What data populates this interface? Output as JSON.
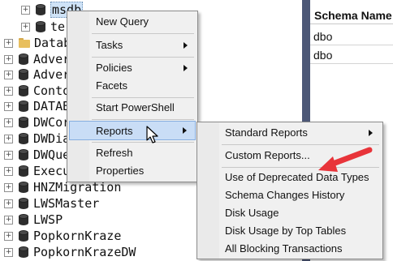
{
  "tree": {
    "items": [
      {
        "label": "msdb",
        "icon": "database-icon",
        "expander": "⊞",
        "selected": true
      },
      {
        "label": "ter",
        "icon": "database-icon",
        "expander": "⊞"
      },
      {
        "label": "Datab",
        "icon": "folder-icon",
        "expander": "⊞"
      },
      {
        "label": "Adver",
        "icon": "database-icon",
        "expander": "⊞"
      },
      {
        "label": "Adver",
        "icon": "database-icon",
        "expander": "⊞"
      },
      {
        "label": "Conto",
        "icon": "database-icon",
        "expander": "⊞"
      },
      {
        "label": "DATAB",
        "icon": "database-icon",
        "expander": "⊞"
      },
      {
        "label": "DWCor",
        "icon": "database-icon",
        "expander": "⊞"
      },
      {
        "label": "DWDia",
        "icon": "database-icon",
        "expander": "⊞"
      },
      {
        "label": "DWQue",
        "icon": "database-icon",
        "expander": "⊞"
      },
      {
        "label": "Execu",
        "icon": "database-icon",
        "expander": "⊞"
      },
      {
        "label": "HNZMigration",
        "icon": "database-icon",
        "expander": "⊞"
      },
      {
        "label": "LWSMaster",
        "icon": "database-icon",
        "expander": "⊞"
      },
      {
        "label": "LWSP",
        "icon": "database-icon",
        "expander": "⊞"
      },
      {
        "label": "PopkornKraze",
        "icon": "database-icon",
        "expander": "⊞"
      },
      {
        "label": "PopkornKrazeDW",
        "icon": "database-icon",
        "expander": "⊞"
      }
    ]
  },
  "results": {
    "column_header": "Schema Name",
    "rows": [
      "dbo",
      "dbo"
    ]
  },
  "context_menu": {
    "items": [
      {
        "label": "New Query",
        "has_submenu": false
      },
      {
        "label": "Tasks",
        "has_submenu": true
      },
      {
        "label": "Policies",
        "has_submenu": true
      },
      {
        "label": "Facets",
        "has_submenu": false
      },
      {
        "label": "Start PowerShell",
        "has_submenu": false
      },
      {
        "label": "Reports",
        "has_submenu": true,
        "highlighted": true
      },
      {
        "label": "Refresh",
        "has_submenu": false
      },
      {
        "label": "Properties",
        "has_submenu": false
      }
    ]
  },
  "reports_submenu": {
    "items": [
      {
        "label": "Standard Reports",
        "has_submenu": true
      },
      {
        "label": "Custom Reports...",
        "has_submenu": false
      },
      {
        "label": "Use of Deprecated Data Types",
        "has_submenu": false
      },
      {
        "label": "Schema Changes History",
        "has_submenu": false
      },
      {
        "label": "Disk Usage",
        "has_submenu": false
      },
      {
        "label": "Disk Usage by Top Tables",
        "has_submenu": false
      },
      {
        "label": "All Blocking Transactions",
        "has_submenu": false
      }
    ]
  },
  "colors": {
    "highlight": "#c9ddf6",
    "divider": "#4d5877",
    "annotation_arrow": "#e8343a"
  }
}
